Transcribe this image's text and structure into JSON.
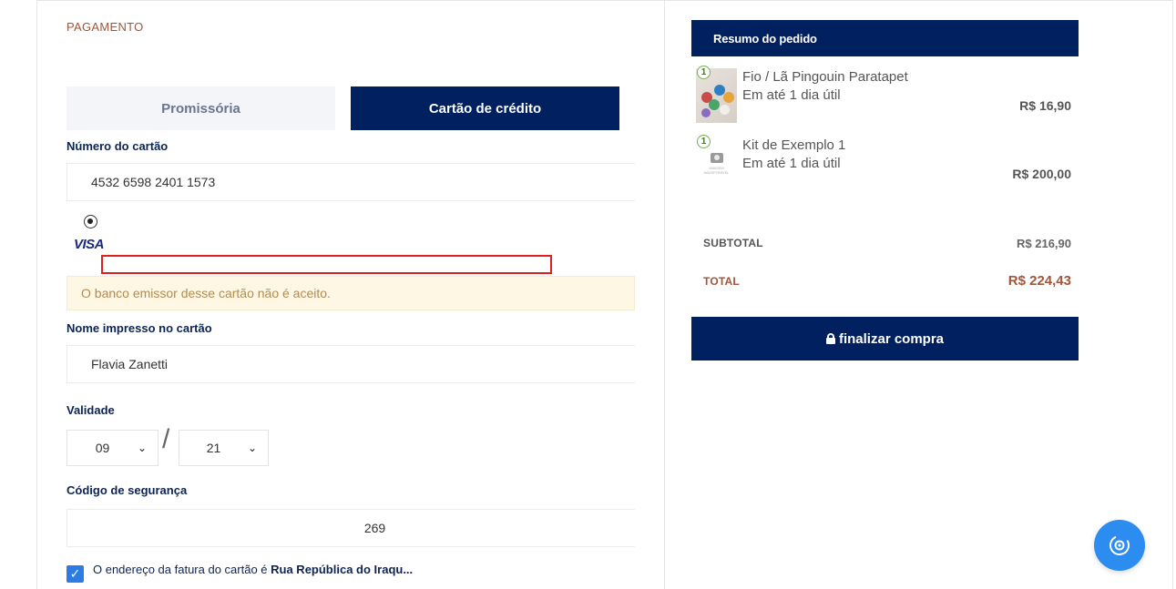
{
  "payment": {
    "section_title": "PAGAMENTO",
    "tabs": [
      {
        "label": "Promissória",
        "active": false
      },
      {
        "label": "Cartão de crédito",
        "active": true
      }
    ],
    "card_number_label": "Número do cartão",
    "card_number_value": "4532 6598 2401 1573",
    "brand_logo_text": "VISA",
    "warning_message": "O banco emissor desse cartão não é aceito.",
    "name_label": "Nome impresso no cartão",
    "name_value": "Flavia Zanetti",
    "expiry_label": "Validade",
    "expiry_month": "09",
    "expiry_separator": "/",
    "expiry_year": "21",
    "cvv_label": "Código de segurança",
    "cvv_value": "269",
    "billing_text": "O endereço da fatura do cartão é ",
    "billing_address": "Rua República do Iraqu...",
    "billing_checked": true
  },
  "summary": {
    "header": "Resumo do pedido",
    "items": [
      {
        "qty": "1",
        "name": "Fio / Lã Pingouin Paratapet",
        "delivery": "Em até 1 dia útil",
        "price": "R$ 16,90",
        "has_image": true
      },
      {
        "qty": "1",
        "name": "Kit de Exemplo 1",
        "delivery": "Em até 1 dia útil",
        "price": "R$ 200,00",
        "has_image": false,
        "placeholder_text": "IMAGEM INDISPONÍVEL"
      }
    ],
    "subtotal_label": "SUBTOTAL",
    "subtotal_value": "R$ 216,90",
    "total_label": "TOTAL",
    "total_value": "R$ 224,43",
    "finalize_label": "finalizar compra"
  },
  "colors": {
    "brand_navy": "#002060",
    "accent_brown": "#a0563a",
    "warning_bg": "#fdf7e4",
    "warning_text": "#b38b52",
    "fab_blue": "#2d8cf0",
    "error_outline": "#e01e1e"
  },
  "icons": {
    "lock": "lock-icon",
    "camera": "camera-icon",
    "chat": "chat-widget-icon",
    "checkmark": "checkmark-icon",
    "chevron": "chevron-down-icon"
  }
}
